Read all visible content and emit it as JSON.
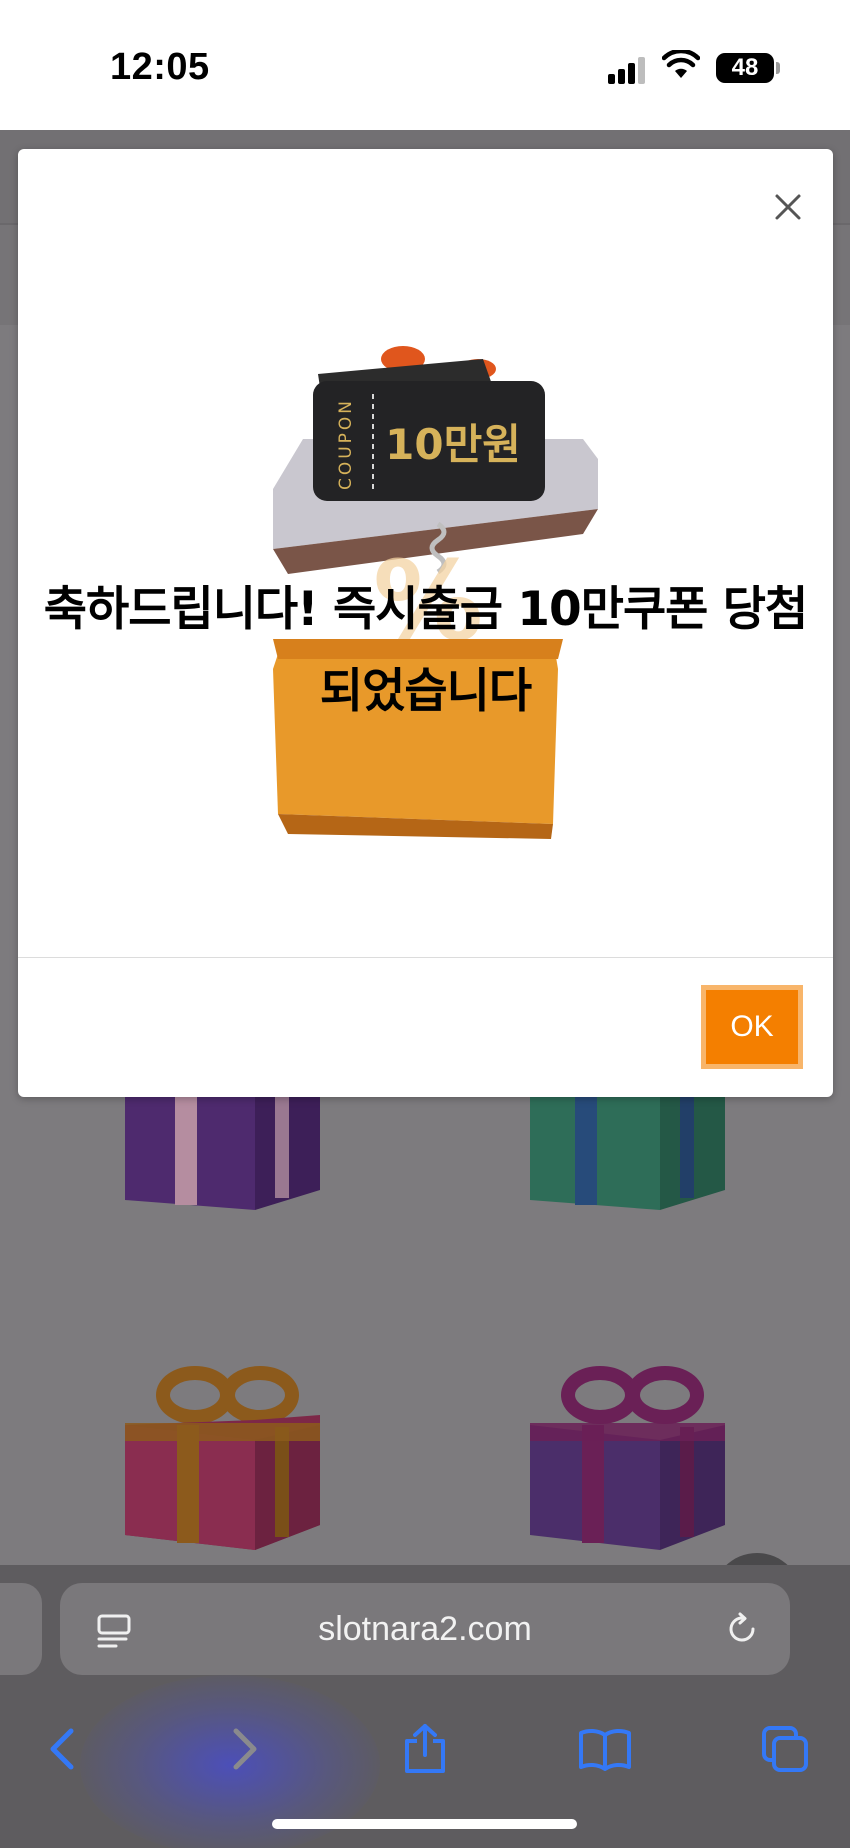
{
  "status_bar": {
    "time": "12:05",
    "battery_level": "48",
    "icons": [
      "signal-icon",
      "wifi-icon",
      "battery-icon"
    ]
  },
  "modal": {
    "message": "축하드립니다! 즉시출금 10만쿠폰 당첨 되었습니다",
    "ok_label": "OK",
    "coupon_tag": "COUPON",
    "coupon_amount": "10만원",
    "colors": {
      "ok_button": "#f47f00",
      "ok_border": "#f8b56a"
    }
  },
  "browser": {
    "url": "slotnara2.com",
    "toolbar_icons": [
      "back-icon",
      "forward-icon",
      "share-icon",
      "bookmarks-icon",
      "tabs-icon"
    ],
    "accent_color": "#3478f6"
  }
}
